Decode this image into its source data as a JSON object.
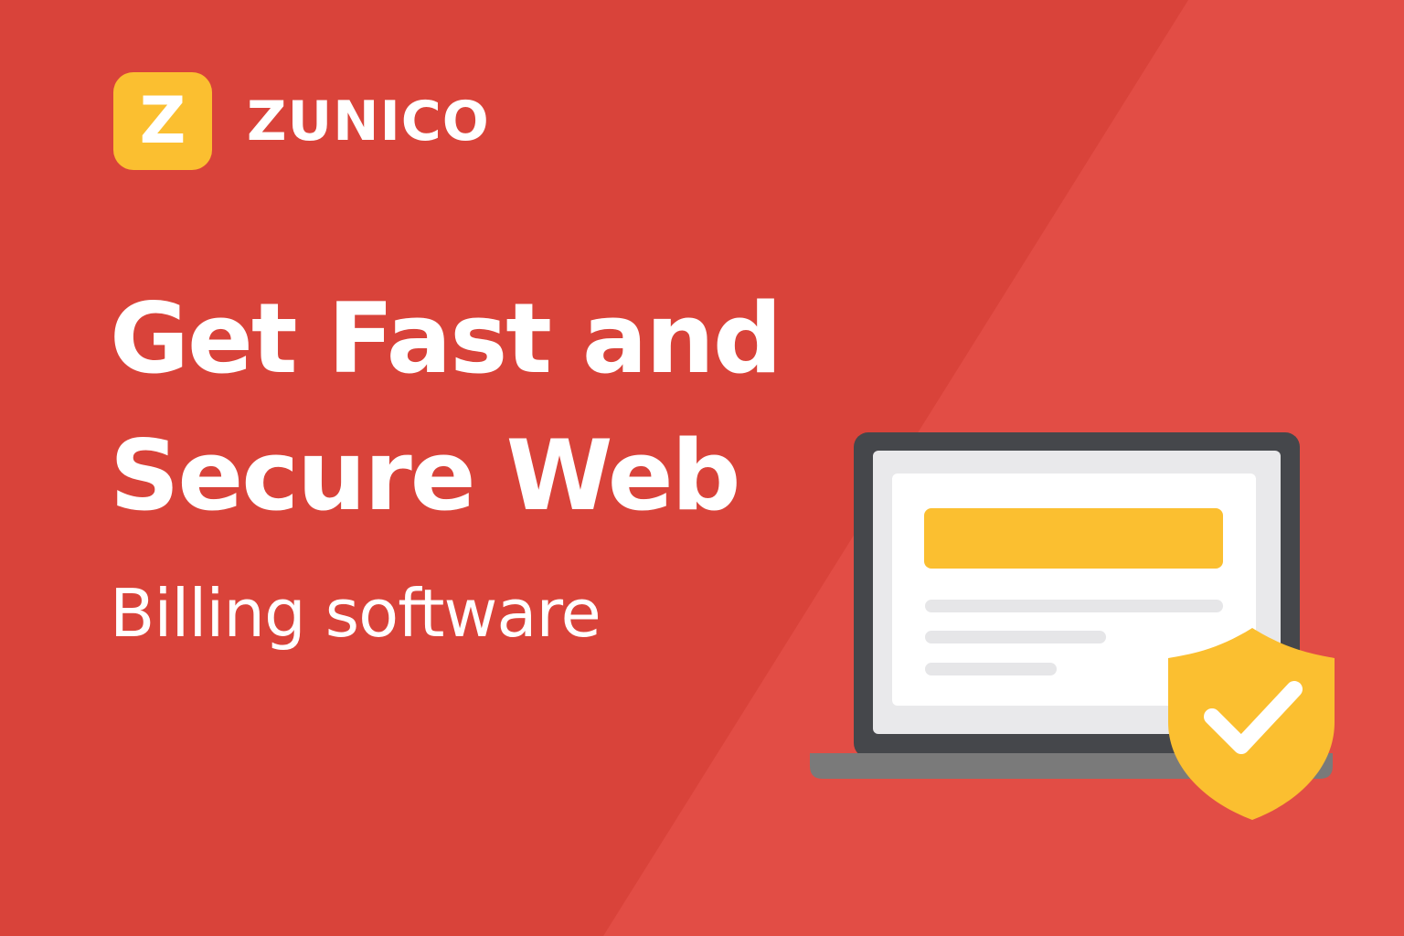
{
  "brand": {
    "logo_letter": "Z",
    "name": "ZUNICO",
    "color": "#fbbf30"
  },
  "hero": {
    "headline_line1": "Get Fast and",
    "headline_line2": "Secure Web",
    "subline": "Billing software"
  },
  "theme": {
    "background": "#d9433a",
    "background_light": "#e24d45",
    "accent": "#fbbf30",
    "text": "#ffffff"
  },
  "illustration": {
    "laptop": "laptop-icon",
    "shield": "shield-check-icon"
  }
}
